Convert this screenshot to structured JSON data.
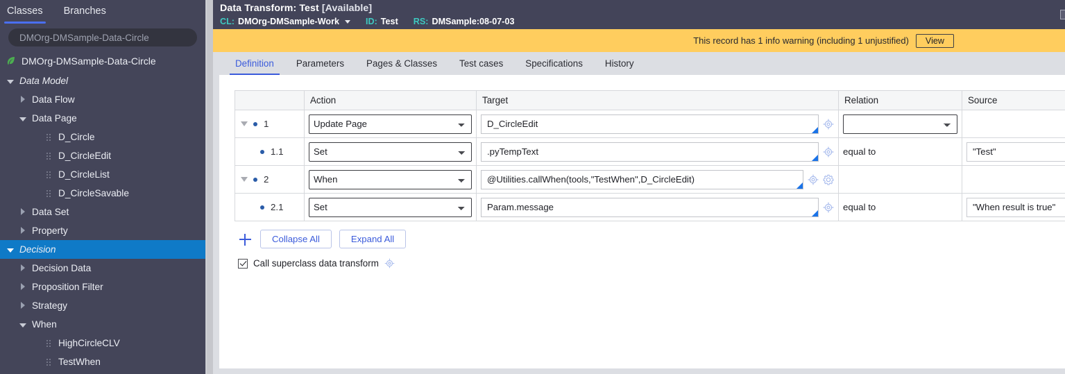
{
  "sidebar": {
    "tabs": [
      {
        "label": "Classes",
        "active": true
      },
      {
        "label": "Branches",
        "active": false
      }
    ],
    "search": {
      "value": "DMOrg-DMSample-Data-Circle",
      "placeholder": "DMOrg-DMSample-Data-Circle"
    },
    "root": {
      "label": "DMOrg-DMSample-Data-Circle",
      "icon": "leaf-icon"
    },
    "tree": [
      {
        "label": "Data Model",
        "level": 1,
        "toggle": "down",
        "italic": true,
        "selected": false,
        "kind": "folder"
      },
      {
        "label": "Data Flow",
        "level": 2,
        "toggle": "right",
        "italic": false,
        "selected": false,
        "kind": "folder"
      },
      {
        "label": "Data Page",
        "level": 2,
        "toggle": "down",
        "italic": false,
        "selected": false,
        "kind": "folder"
      },
      {
        "label": "D_Circle",
        "level": 3,
        "toggle": "none",
        "italic": false,
        "selected": false,
        "kind": "leaf"
      },
      {
        "label": "D_CircleEdit",
        "level": 3,
        "toggle": "none",
        "italic": false,
        "selected": false,
        "kind": "leaf"
      },
      {
        "label": "D_CircleList",
        "level": 3,
        "toggle": "none",
        "italic": false,
        "selected": false,
        "kind": "leaf"
      },
      {
        "label": "D_CircleSavable",
        "level": 3,
        "toggle": "none",
        "italic": false,
        "selected": false,
        "kind": "leaf"
      },
      {
        "label": "Data Set",
        "level": 2,
        "toggle": "right",
        "italic": false,
        "selected": false,
        "kind": "folder"
      },
      {
        "label": "Property",
        "level": 2,
        "toggle": "right",
        "italic": false,
        "selected": false,
        "kind": "folder"
      },
      {
        "label": "Decision",
        "level": 1,
        "toggle": "down",
        "italic": true,
        "selected": true,
        "kind": "folder"
      },
      {
        "label": "Decision Data",
        "level": 2,
        "toggle": "right",
        "italic": false,
        "selected": false,
        "kind": "folder"
      },
      {
        "label": "Proposition Filter",
        "level": 2,
        "toggle": "right",
        "italic": false,
        "selected": false,
        "kind": "folder"
      },
      {
        "label": "Strategy",
        "level": 2,
        "toggle": "right",
        "italic": false,
        "selected": false,
        "kind": "folder"
      },
      {
        "label": "When",
        "level": 2,
        "toggle": "down",
        "italic": false,
        "selected": false,
        "kind": "folder"
      },
      {
        "label": "HighCircleCLV",
        "level": 3,
        "toggle": "none",
        "italic": false,
        "selected": false,
        "kind": "leaf"
      },
      {
        "label": "TestWhen",
        "level": 3,
        "toggle": "none",
        "italic": false,
        "selected": false,
        "kind": "leaf"
      }
    ]
  },
  "header": {
    "title_main": "Data Transform: Test",
    "title_status": "[Available]",
    "cl_label": "CL:",
    "cl_value": "DMOrg-DMSample-Work",
    "id_label": "ID:",
    "id_value": "Test",
    "rs_label": "RS:",
    "rs_value": "DMSample:08-07-03"
  },
  "warning": {
    "message": "This record has 1 info warning (including 1 unjustified)",
    "button": "View"
  },
  "tabs": [
    {
      "label": "Definition",
      "active": true
    },
    {
      "label": "Parameters",
      "active": false
    },
    {
      "label": "Pages & Classes",
      "active": false
    },
    {
      "label": "Test cases",
      "active": false
    },
    {
      "label": "Specifications",
      "active": false
    },
    {
      "label": "History",
      "active": false
    }
  ],
  "table": {
    "columns": [
      "",
      "Action",
      "Target",
      "Relation",
      "Source"
    ],
    "rows": [
      {
        "index": "1",
        "sub": false,
        "toggle": true,
        "action": "Update Page",
        "target": "D_CircleEdit",
        "has_gear": false,
        "relation_is_select": true,
        "relation": "",
        "source": ""
      },
      {
        "index": "1.1",
        "sub": true,
        "toggle": false,
        "action": "Set",
        "target": ".pyTempText",
        "has_gear": false,
        "relation_is_select": false,
        "relation": "equal to",
        "source": "\"Test\""
      },
      {
        "index": "2",
        "sub": false,
        "toggle": true,
        "action": "When",
        "target": "@Utilities.callWhen(tools,\"TestWhen\",D_CircleEdit)",
        "has_gear": true,
        "relation_is_select": false,
        "relation": "",
        "source": ""
      },
      {
        "index": "2.1",
        "sub": true,
        "toggle": false,
        "action": "Set",
        "target": "Param.message",
        "has_gear": false,
        "relation_is_select": false,
        "relation": "equal to",
        "source": "\"When result is true\""
      }
    ]
  },
  "controls": {
    "add_label": "+",
    "collapse_all": "Collapse All",
    "expand_all": "Expand All",
    "superclass_checkbox_label": "Call superclass data transform",
    "superclass_checked": true
  },
  "colors": {
    "sidebar_bg": "#444559",
    "header_bg": "#434459",
    "accent_blue": "#3b5bdb",
    "selection_blue": "#0f7ac7",
    "warning_yellow": "#ffcd5e",
    "teal_label": "#3ec9c0",
    "page_bg": "#dcdee3"
  }
}
